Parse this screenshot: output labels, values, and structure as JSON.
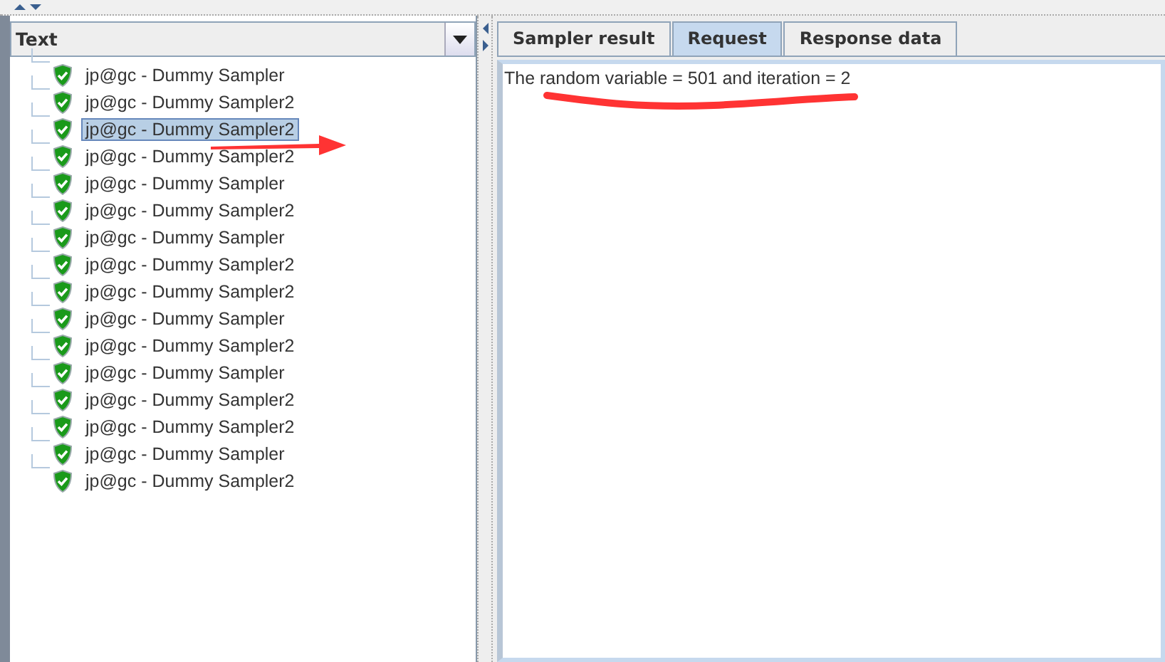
{
  "left_panel": {
    "dropdown": {
      "value": "Text"
    },
    "tree": [
      {
        "label": "jp@gc - Dummy Sampler",
        "selected": false
      },
      {
        "label": "jp@gc - Dummy Sampler2",
        "selected": false
      },
      {
        "label": "jp@gc - Dummy Sampler2",
        "selected": true
      },
      {
        "label": "jp@gc - Dummy Sampler2",
        "selected": false
      },
      {
        "label": "jp@gc - Dummy Sampler",
        "selected": false
      },
      {
        "label": "jp@gc - Dummy Sampler2",
        "selected": false
      },
      {
        "label": "jp@gc - Dummy Sampler",
        "selected": false
      },
      {
        "label": "jp@gc - Dummy Sampler2",
        "selected": false
      },
      {
        "label": "jp@gc - Dummy Sampler2",
        "selected": false
      },
      {
        "label": "jp@gc - Dummy Sampler",
        "selected": false
      },
      {
        "label": "jp@gc - Dummy Sampler2",
        "selected": false
      },
      {
        "label": "jp@gc - Dummy Sampler",
        "selected": false
      },
      {
        "label": "jp@gc - Dummy Sampler2",
        "selected": false
      },
      {
        "label": "jp@gc - Dummy Sampler2",
        "selected": false
      },
      {
        "label": "jp@gc - Dummy Sampler",
        "selected": false
      },
      {
        "label": "jp@gc - Dummy Sampler2",
        "selected": false
      }
    ]
  },
  "right_panel": {
    "tabs": [
      {
        "label": "Sampler result",
        "selected": false
      },
      {
        "label": "Request",
        "selected": true
      },
      {
        "label": "Response data",
        "selected": false
      }
    ],
    "content": "The random variable = 501 and iteration = 2"
  }
}
